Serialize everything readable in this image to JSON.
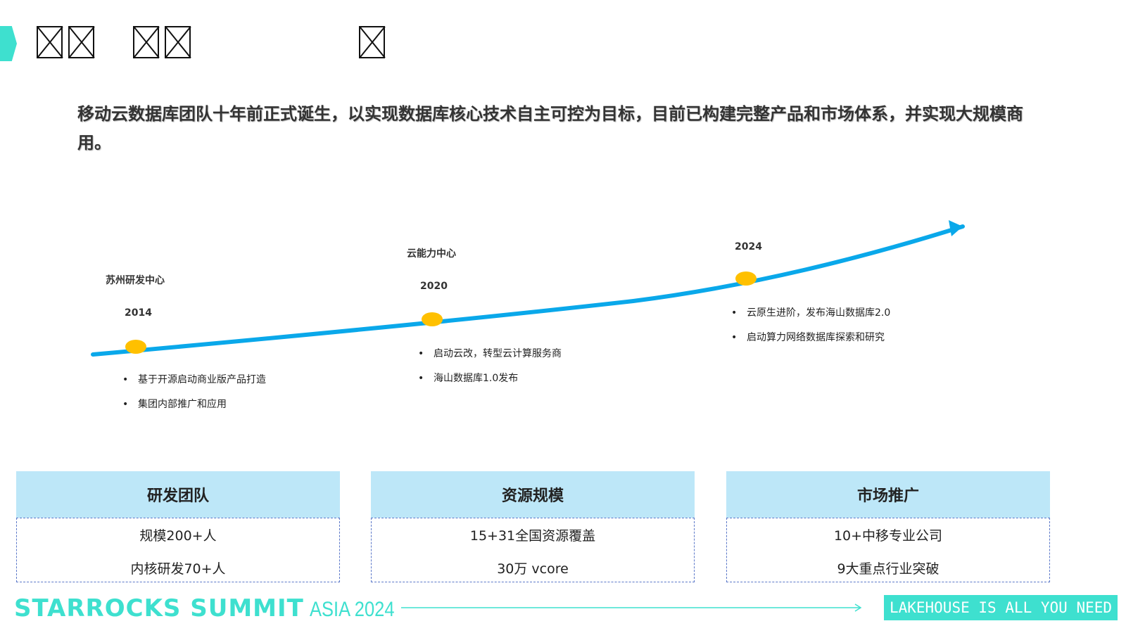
{
  "intro_text": "移动云数据库团队十年前正式诞生，以实现数据库核心技术自主可控为目标，目前已构建完整产品和市场体系，并实现大规模商用。",
  "timeline": [
    {
      "label": "苏州研发中心",
      "year": "2014",
      "bullets": [
        "基于开源启动商业版产品打造",
        "集团内部推广和应用"
      ]
    },
    {
      "label": "云能力中心",
      "year": "2020",
      "bullets": [
        "启动云改，转型云计算服务商",
        "海山数据库1.0发布"
      ]
    },
    {
      "label": "",
      "year": "2024",
      "bullets": [
        "云原生进阶，发布海山数据库2.0",
        "启动算力网络数据库探索和研究"
      ]
    }
  ],
  "cards": [
    {
      "title": "研发团队",
      "line1": "规模200+人",
      "line2": "内核研发70+人"
    },
    {
      "title": "资源规模",
      "line1": "15+31全国资源覆盖",
      "line2": "30万 vcore"
    },
    {
      "title": "市场推广",
      "line1": "10+中移专业公司",
      "line2": "9大重点行业突破"
    }
  ],
  "footer": {
    "brand": "STARROCKS SUMMIT",
    "event": "ASIA 2024",
    "tagline": "LAKEHOUSE IS ALL YOU NEED"
  },
  "colors": {
    "accent": "#3ee0cf",
    "timeline_line": "#0aa8ea",
    "milestone_dot": "#ffc000",
    "card_header": "#bde7f8",
    "card_border": "#5b78c9"
  }
}
